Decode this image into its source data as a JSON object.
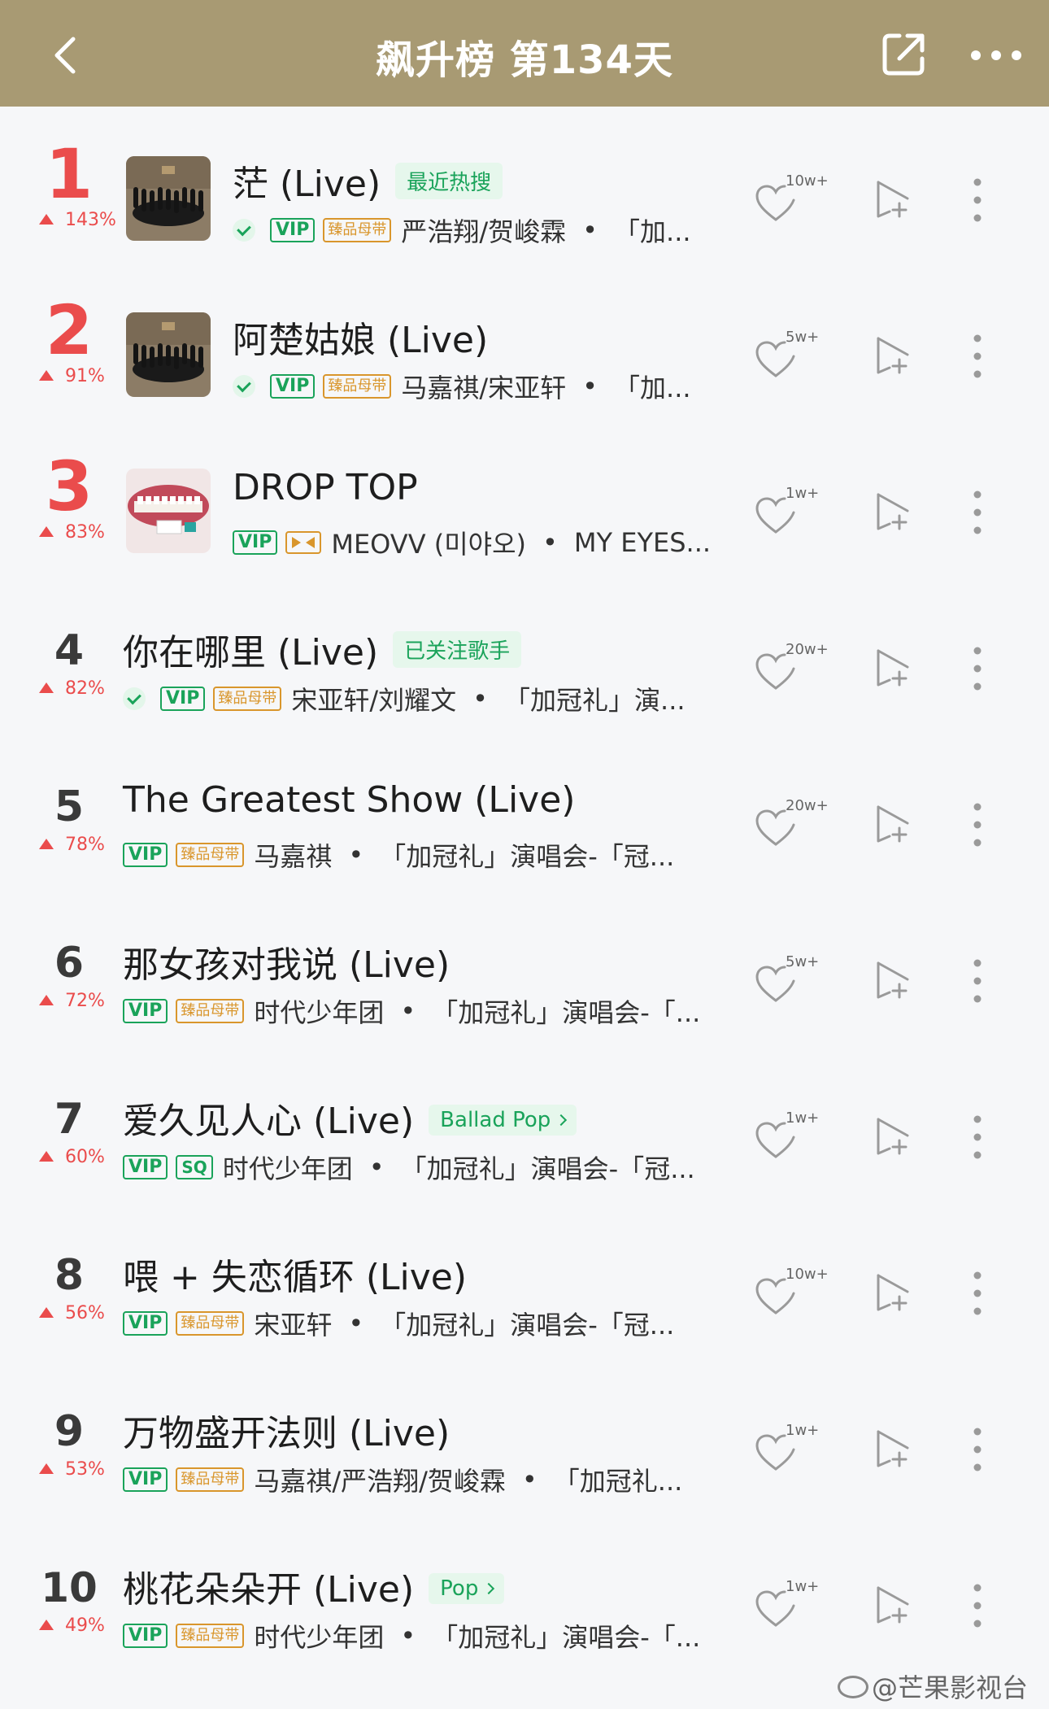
{
  "header": {
    "title": "飙升榜 第134天",
    "background": "#a89a73",
    "back_icon": "back-arrow-icon",
    "share_icon": "share-icon",
    "more_icon": "more-icon"
  },
  "songs": [
    {
      "rank": "1",
      "change": "143%",
      "title": "茫 (Live)",
      "tag": "最近热搜",
      "tag_arrow": false,
      "followed": true,
      "quality": [
        "VIP",
        "臻品母带"
      ],
      "artist": "严浩翔/贺峻霖",
      "album": "「加...",
      "likes": "10w+"
    },
    {
      "rank": "2",
      "change": "91%",
      "title": "阿楚姑娘 (Live)",
      "tag": "",
      "tag_arrow": false,
      "followed": true,
      "quality": [
        "VIP",
        "臻品母带"
      ],
      "artist": "马嘉祺/宋亚轩",
      "album": "「加...",
      "likes": "5w+"
    },
    {
      "rank": "3",
      "change": "83%",
      "title": "DROP TOP",
      "tag": "",
      "tag_arrow": false,
      "followed": false,
      "quality": [
        "VIP",
        "dolby"
      ],
      "artist": "MEOVV (미야오)",
      "album": "MY EYES...",
      "likes": "1w+"
    },
    {
      "rank": "4",
      "change": "82%",
      "title": "你在哪里 (Live)",
      "tag": "已关注歌手",
      "tag_arrow": false,
      "followed": true,
      "quality": [
        "VIP",
        "臻品母带"
      ],
      "artist": "宋亚轩/刘耀文",
      "album": "「加冠礼」演...",
      "likes": "20w+"
    },
    {
      "rank": "5",
      "change": "78%",
      "title": "The Greatest Show (Live)",
      "tag": "",
      "tag_arrow": false,
      "followed": false,
      "quality": [
        "VIP",
        "臻品母带"
      ],
      "artist": "马嘉祺",
      "album": "「加冠礼」演唱会-「冠...",
      "likes": "20w+"
    },
    {
      "rank": "6",
      "change": "72%",
      "title": "那女孩对我说 (Live)",
      "tag": "",
      "tag_arrow": false,
      "followed": false,
      "quality": [
        "VIP",
        "臻品母带"
      ],
      "artist": "时代少年团",
      "album": "「加冠礼」演唱会-「...",
      "likes": "5w+"
    },
    {
      "rank": "7",
      "change": "60%",
      "title": "爱久见人心 (Live)",
      "tag": "Ballad Pop",
      "tag_arrow": true,
      "followed": false,
      "quality": [
        "VIP",
        "SQ"
      ],
      "artist": "时代少年团",
      "album": "「加冠礼」演唱会-「冠...",
      "likes": "1w+"
    },
    {
      "rank": "8",
      "change": "56%",
      "title": "喂 + 失恋循环 (Live)",
      "tag": "",
      "tag_arrow": false,
      "followed": false,
      "quality": [
        "VIP",
        "臻品母带"
      ],
      "artist": "宋亚轩",
      "album": "「加冠礼」演唱会-「冠...",
      "likes": "10w+"
    },
    {
      "rank": "9",
      "change": "53%",
      "title": "万物盛开法则 (Live)",
      "tag": "",
      "tag_arrow": false,
      "followed": false,
      "quality": [
        "VIP",
        "臻品母带"
      ],
      "artist": "马嘉祺/严浩翔/贺峻霖",
      "album": "「加冠礼...",
      "likes": "1w+"
    },
    {
      "rank": "10",
      "change": "49%",
      "title": "桃花朵朵开 (Live)",
      "tag": "Pop",
      "tag_arrow": true,
      "followed": false,
      "quality": [
        "VIP",
        "臻品母带"
      ],
      "artist": "时代少年团",
      "album": "「加冠礼」演唱会-「...",
      "likes": "1w+"
    }
  ],
  "watermark": "@芒果影视台",
  "colors": {
    "accent_red": "#ea4c4c",
    "green": "#1aa35a",
    "gold": "#d9962c"
  }
}
